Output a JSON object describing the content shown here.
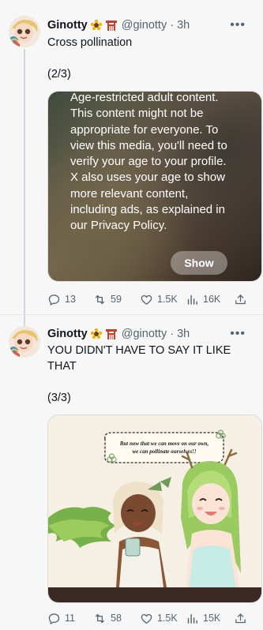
{
  "tweets": [
    {
      "author": "Ginotty",
      "handle": "@ginotty",
      "time": "3h",
      "text": "Cross pollination\n\n(2/3)",
      "media_type": "age-restricted",
      "warning": "Age-restricted adult content. This content might not be appropriate for everyone. To view this media, you'll need to verify your age to your profile. X also uses your age to show more relevant content, including ads, as explained in our Privacy Policy.",
      "show_label": "Show",
      "stats": {
        "replies": "13",
        "reposts": "59",
        "likes": "1.5K",
        "views": "16K"
      }
    },
    {
      "author": "Ginotty",
      "handle": "@ginotty",
      "time": "3h",
      "text": "YOU DIDN'T HAVE TO SAY IT LIKE THAT\n\n(3/3)",
      "media_type": "image",
      "speech_bubble": "But now that we can move on our own, we can pollinate ourselves!!",
      "stats": {
        "replies": "11",
        "reposts": "58",
        "likes": "1.5K",
        "views": "15K"
      }
    }
  ],
  "separator": "·",
  "more_icon": "more-horizontal-icon",
  "icons": {
    "reply": "reply-icon",
    "repost": "repost-icon",
    "like": "heart-icon",
    "views": "views-icon",
    "share": "share-icon"
  },
  "colors": {
    "background": "#f7f7f7",
    "text": "#0f1419",
    "secondary": "#536471",
    "thread_line": "#cfd9de"
  }
}
